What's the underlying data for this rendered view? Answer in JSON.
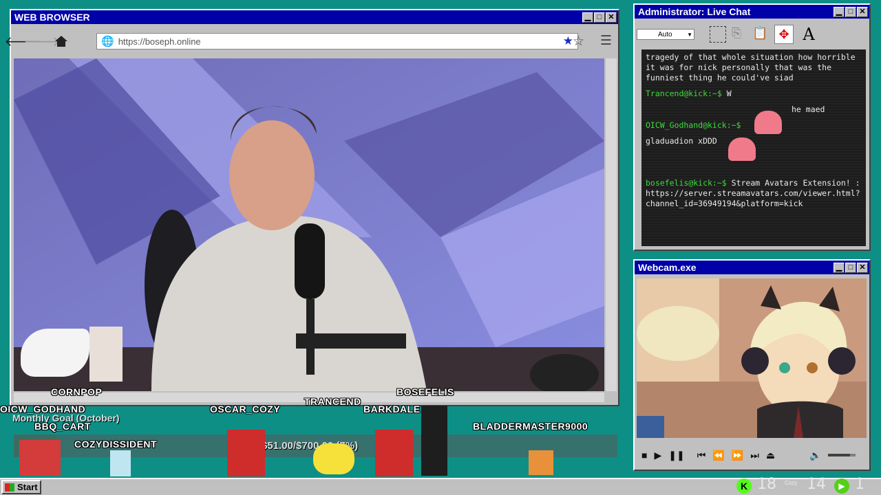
{
  "browser": {
    "title": "WEB BROWSER",
    "url": "https://boseph.online",
    "icons": {
      "back": "arrow-left-icon",
      "forward": "arrow-right-icon",
      "home": "home-icon",
      "globe": "globe-icon",
      "bookmarked": "star-filled-icon",
      "bookmark": "star-outline-icon",
      "menu": "hamburger-icon"
    }
  },
  "chat": {
    "title": "Administrator: Live Chat",
    "font_select": "Auto",
    "messages": [
      {
        "user": "",
        "text": "tragedy of that whole situation how horrible it was for nick personally that was the funniest thing he could've siad"
      },
      {
        "user": "Trancend@kick:~$",
        "text": "W"
      },
      {
        "user": "",
        "text": "he maed"
      },
      {
        "user": "OICW_Godhand@kick:~$",
        "text": ""
      },
      {
        "user": "",
        "text": "gladuadion xDDD"
      },
      {
        "user": "bosefelis@kick:~$",
        "text": "Stream Avatars Extension! : https://server.streamavatars.com/viewer.html?channel_id=36949194&platform=kick"
      }
    ]
  },
  "webcam": {
    "title": "Webcam.exe",
    "volume": 0.8
  },
  "overlay": {
    "goal_title": "Monthly Goal (October)",
    "goal_text": "$51.00/$700.00 (7%)",
    "goal_progress": 0.07,
    "avatars": [
      "CORNPOP",
      "OICW_GODHAND",
      "BBQ_CART",
      "COZYDISSIDENT",
      "OSCAR_COZY",
      "TRANCEND",
      "BOSEFELIS",
      "BARKDALE",
      "BLADDERMASTER9000"
    ]
  },
  "taskbar": {
    "start_label": "Start",
    "stat1": "18",
    "stat2": "14",
    "stat3": "1",
    "stat_small": "Cozy"
  },
  "colors": {
    "titlebar": "#0000a8",
    "desktop": "#0d8f86",
    "chat_user": "#3ddc3d",
    "kick": "#53fc18"
  }
}
